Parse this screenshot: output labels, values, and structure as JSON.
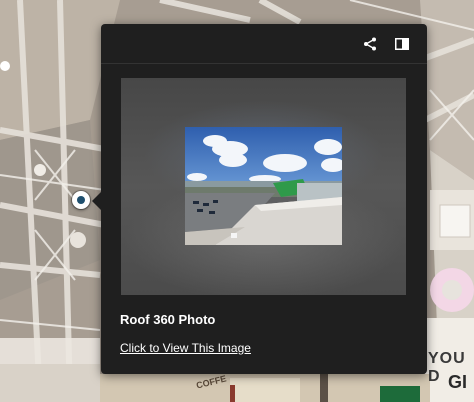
{
  "hotspot": {
    "icon": "hotspot-marker-icon"
  },
  "popup": {
    "title": "Roof 360 Photo",
    "link_text": "Click to View This Image",
    "actions": [
      {
        "icon": "share-icon"
      },
      {
        "icon": "panel-icon"
      }
    ],
    "image": {
      "icon": "rooftop-photo"
    }
  },
  "background": {
    "wall_text_1": "YOU D",
    "wall_text_2": "GI",
    "wall_text_3": "COFFE"
  },
  "colors": {
    "card_bg": "#1f1f1f",
    "card_text": "#ffffff",
    "hotspot_dot": "#1f4f6e",
    "sky": "#3f6db5",
    "green_accent": "#2f9a4a"
  }
}
